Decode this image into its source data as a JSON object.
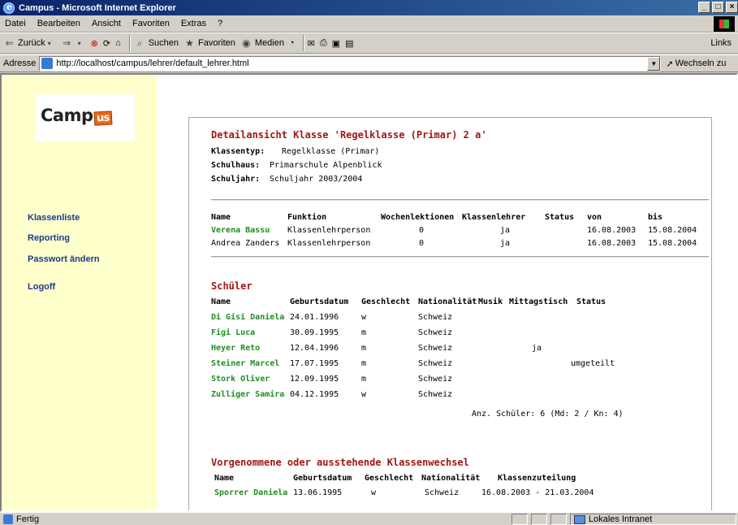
{
  "window": {
    "title": "Campus - Microsoft Internet Explorer"
  },
  "menu": [
    "Datei",
    "Bearbeiten",
    "Ansicht",
    "Favoriten",
    "Extras",
    "?"
  ],
  "toolbar": {
    "back": "Zurück",
    "search": "Suchen",
    "favorites": "Favoriten",
    "media": "Medien",
    "links": "Links"
  },
  "address": {
    "label": "Adresse",
    "url": "http://localhost/campus/lehrer/default_lehrer.html",
    "go": "Wechseln zu"
  },
  "sidebar": {
    "logo_text": "Camp",
    "logo_accent": "us",
    "links": [
      "Klassenliste",
      "Reporting",
      "Passwort ändern",
      "Logoff"
    ]
  },
  "detail": {
    "title": "Detailansicht Klasse 'Regelklasse (Primar) 2 a'",
    "fields": [
      {
        "label": "Klassentyp:",
        "value": "Regelklasse (Primar)"
      },
      {
        "label": "Schulhaus:",
        "value": "Primarschule Alpenblick"
      },
      {
        "label": "Schuljahr:",
        "value": "Schuljahr 2003/2004"
      }
    ]
  },
  "teachers": {
    "headers": [
      "Name",
      "Funktion",
      "Wochenlektionen",
      "Klassenlehrer",
      "Status",
      "von",
      "bis"
    ],
    "rows": [
      {
        "name": "Verena Bassu",
        "funktion": "Klassenlehrperson",
        "lektionen": "0",
        "klassenlehrer": "ja",
        "status": "",
        "von": "16.08.2003",
        "bis": "15.08.2004",
        "link": true
      },
      {
        "name": "Andrea Zanders",
        "funktion": "Klassenlehrperson",
        "lektionen": "0",
        "klassenlehrer": "ja",
        "status": "",
        "von": "16.08.2003",
        "bis": "15.08.2004",
        "link": false
      }
    ]
  },
  "students": {
    "title": "Schüler",
    "headers": [
      "Name",
      "Geburtsdatum",
      "Geschlecht",
      "Nationalität",
      "Musik",
      "Mittagstisch",
      "Status"
    ],
    "rows": [
      {
        "name": "Di Gisi Daniela",
        "geb": "24.01.1996",
        "g": "w",
        "nat": "Schweiz",
        "musik": "",
        "mittag": "",
        "status": ""
      },
      {
        "name": "Figi Luca",
        "geb": "30.09.1995",
        "g": "m",
        "nat": "Schweiz",
        "musik": "",
        "mittag": "",
        "status": ""
      },
      {
        "name": "Heyer Reto",
        "geb": "12.04.1996",
        "g": "m",
        "nat": "Schweiz",
        "musik": "",
        "mittag": "ja",
        "status": ""
      },
      {
        "name": "Steiner Marcel",
        "geb": "17.07.1995",
        "g": "m",
        "nat": "Schweiz",
        "musik": "",
        "mittag": "",
        "status": "umgeteilt"
      },
      {
        "name": "Stork Oliver",
        "geb": "12.09.1995",
        "g": "m",
        "nat": "Schweiz",
        "musik": "",
        "mittag": "",
        "status": ""
      },
      {
        "name": "Zulliger Samira",
        "geb": "04.12.1995",
        "g": "w",
        "nat": "Schweiz",
        "musik": "",
        "mittag": "",
        "status": ""
      }
    ],
    "summary": "Anz. Schüler: 6 (Md: 2 / Kn: 4)"
  },
  "changes": {
    "title": "Vorgenommene oder ausstehende Klassenwechsel",
    "headers": [
      "Name",
      "Geburtsdatum",
      "Geschlecht",
      "Nationalität",
      "Klassenzuteilung"
    ],
    "rows": [
      {
        "name": "Sporrer Daniela",
        "geb": "13.06.1995",
        "g": "w",
        "nat": "Schweiz",
        "zuteilung": "16.08.2003 - 21.03.2004"
      }
    ]
  },
  "status": {
    "text": "Fertig",
    "zone": "Lokales Intranet"
  }
}
